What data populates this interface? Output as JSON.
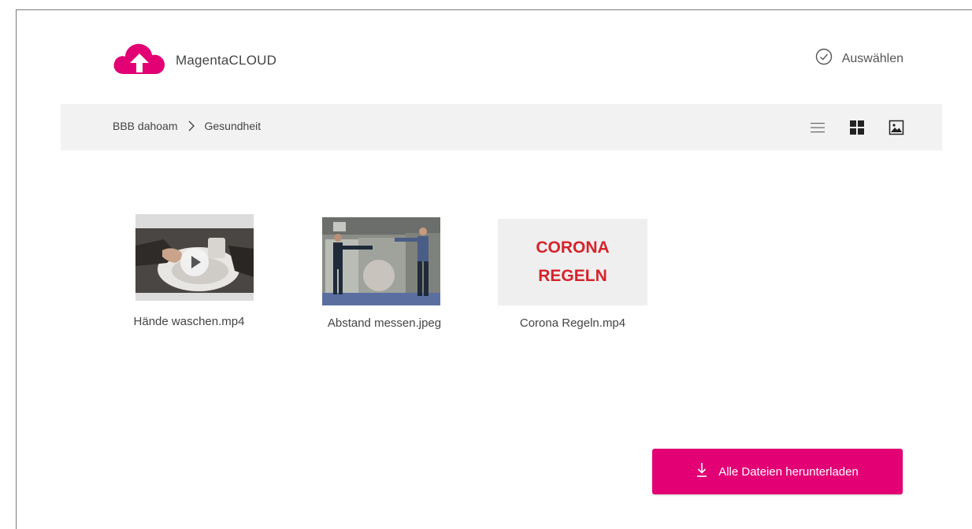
{
  "app": {
    "name": "MagentaCLOUD",
    "brand_color": "#e20074"
  },
  "header": {
    "select_label": "Auswählen"
  },
  "breadcrumb": [
    "BBB dahoam",
    "Gesundheit"
  ],
  "view_modes": [
    "list-view-icon",
    "grid-view-icon",
    "gallery-view-icon"
  ],
  "files": [
    {
      "name": "Hände waschen.mp4",
      "type": "video"
    },
    {
      "name": "Abstand messen.jpeg",
      "type": "image"
    },
    {
      "name": "Corona Regeln.mp4",
      "type": "video",
      "thumb_text": [
        "CORONA",
        "REGELN"
      ]
    }
  ],
  "actions": {
    "download_all": "Alle Dateien herunterladen"
  }
}
